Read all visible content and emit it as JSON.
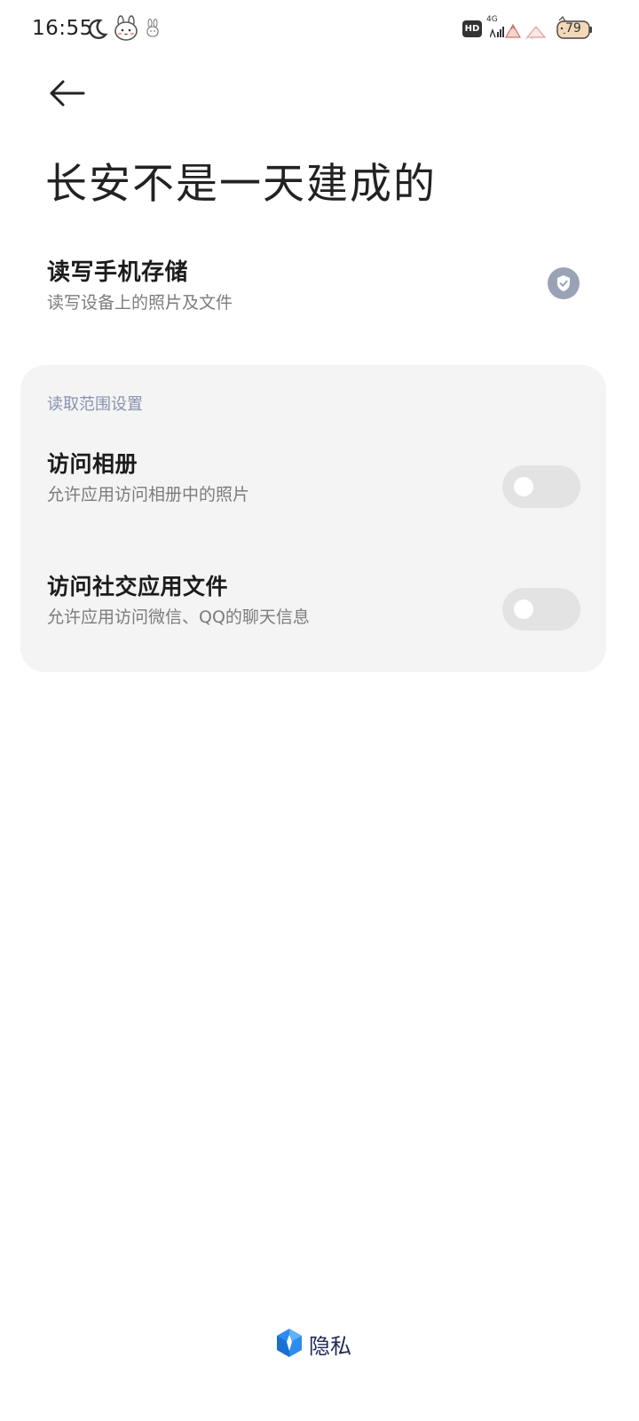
{
  "status_bar": {
    "time": "16:55",
    "network_type": "4G",
    "hd_label": "HD",
    "battery_level": "79",
    "icons": [
      "moon-icon",
      "bunny-sticker-icon",
      "bunny-small-icon",
      "hd-icon",
      "signal-4g-icon",
      "wifi-deco-icon",
      "battery-icon"
    ]
  },
  "header": {
    "back_icon": "back-arrow-icon",
    "title": "长安不是一天建成的"
  },
  "permission": {
    "title": "读写手机存储",
    "description": "读写设备上的照片及文件",
    "state_icon": "shield-check-icon"
  },
  "read_scope": {
    "section_title": "读取范围设置",
    "items": [
      {
        "title": "访问相册",
        "description": "允许应用访问相册中的照片",
        "enabled": false
      },
      {
        "title": "访问社交应用文件",
        "description": "允许应用访问微信、QQ的聊天信息",
        "enabled": false
      }
    ]
  },
  "footer": {
    "brand_label": "隐私",
    "brand_icon": "privacy-shield-icon"
  },
  "colors": {
    "background": "#ffffff",
    "card_background": "#f4f4f4",
    "section_header": "#8792ad",
    "secondary_text": "#7c7c7c",
    "toggle_off": "#e3e3e3",
    "badge": "#9aa3b6",
    "brand_accent": "#2d8cf0"
  }
}
